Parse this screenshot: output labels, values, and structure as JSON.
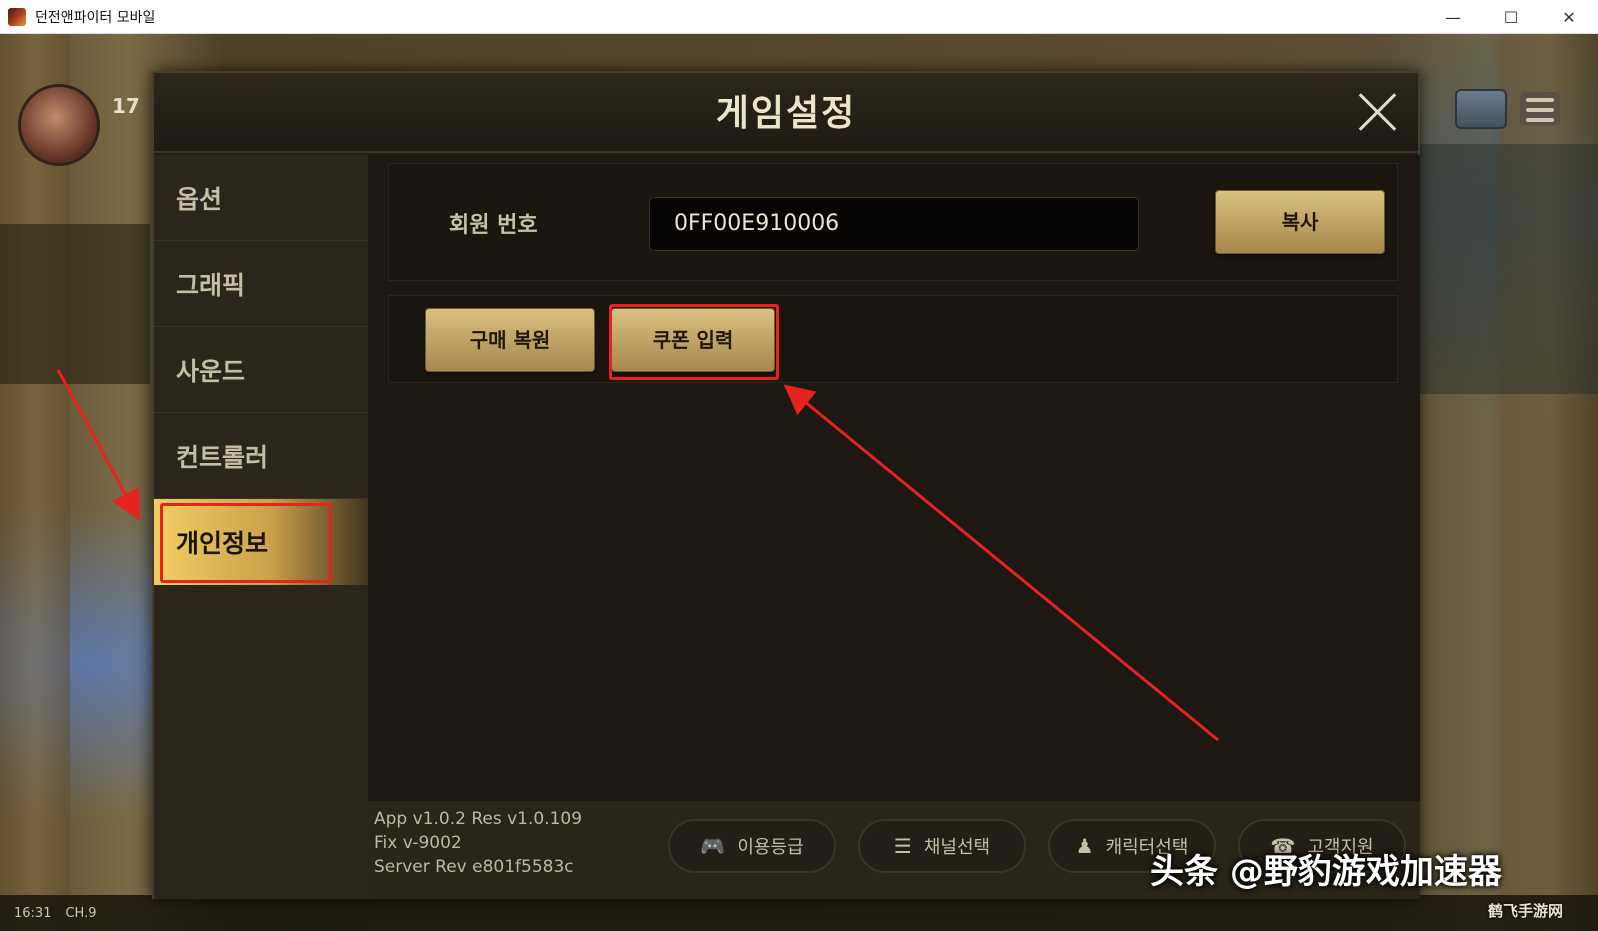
{
  "window": {
    "title": "던전앤파이터 모바일",
    "minimize": "—",
    "maximize": "☐",
    "close": "✕"
  },
  "hud": {
    "level": "17",
    "clock": "16:31",
    "channel": "CH.9"
  },
  "dialog": {
    "title": "게임설정",
    "close_icon": "close-icon"
  },
  "sidebar": {
    "items": [
      {
        "label": "옵션"
      },
      {
        "label": "그래픽"
      },
      {
        "label": "사운드"
      },
      {
        "label": "컨트롤러"
      },
      {
        "label": "개인정보",
        "active": true
      }
    ]
  },
  "content": {
    "member_label": "회원 번호",
    "member_number": "0FF00E910006",
    "copy_button": "복사",
    "restore_button": "구매 복원",
    "coupon_button": "쿠폰 입력"
  },
  "footer": {
    "version_lines": [
      "App v1.0.2 Res v1.0.109",
      "Fix v-9002",
      "Server Rev e801f5583c"
    ],
    "buttons": [
      {
        "label": "이용등급",
        "icon": "gamepad-icon"
      },
      {
        "label": "채널선택",
        "icon": "list-icon"
      },
      {
        "label": "캐릭터선택",
        "icon": "character-icon"
      },
      {
        "label": "고객지원",
        "icon": "support-icon"
      }
    ]
  },
  "watermark": {
    "text": "头条 @野豹游戏加速器",
    "corner": "鹤飞手游网"
  },
  "colors": {
    "accent_gold": "#d9c080",
    "annotation_red": "#e8231f",
    "dialog_bg": "#221d15"
  }
}
